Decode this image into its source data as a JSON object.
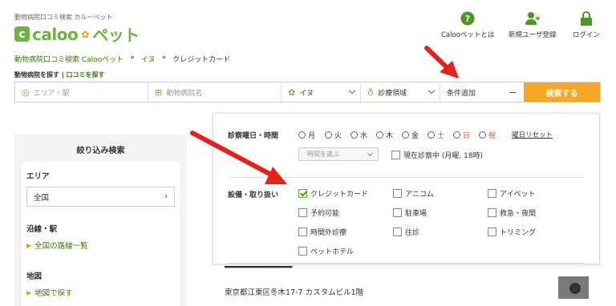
{
  "header": {
    "tagline": "動物病院口コミ検索 カルーペット",
    "logo_main": "caloo",
    "logo_sub": "ペット",
    "nav": [
      {
        "label": "Calooペットとは",
        "icon": "help-icon"
      },
      {
        "label": "新規ユーザ登録",
        "icon": "add-user-icon"
      },
      {
        "label": "ログイン",
        "icon": "lock-icon"
      }
    ]
  },
  "breadcrumb": {
    "items": [
      "動物病院口コミ検索 Calooペット",
      "イヌ",
      "クレジットカード"
    ],
    "sep": "»"
  },
  "subnav": {
    "find_hospital": "動物病院を探す",
    "sep": "|",
    "find_reviews": "口コミを探す"
  },
  "search": {
    "area_placeholder": "エリア・駅",
    "hospital_placeholder": "動物病院名",
    "animal": "イヌ",
    "field": "診療領域",
    "conditions": "条件追加",
    "submit": "検索する"
  },
  "sidebar": {
    "title": "絞り込み検索",
    "area_label": "エリア",
    "area_value": "全国",
    "line_label": "沿線・駅",
    "line_link": "全国の路線一覧",
    "map_label": "地図",
    "map_link": "地図で探す"
  },
  "panel": {
    "day_label": "診察曜日・時間",
    "days": [
      "月",
      "火",
      "水",
      "木",
      "金",
      "土",
      "日",
      "祝"
    ],
    "reset": "曜日リセット",
    "time_placeholder": "時間を選ぶ",
    "open_now": "現在診察中 (月曜, 18時)",
    "facility_label": "設備・取り扱い",
    "facilities": [
      {
        "label": "クレジットカード",
        "checked": true
      },
      {
        "label": "アニコム",
        "checked": false
      },
      {
        "label": "アイペット",
        "checked": false
      },
      {
        "label": "予約可能",
        "checked": false
      },
      {
        "label": "駐車場",
        "checked": false
      },
      {
        "label": "救急・夜間",
        "checked": false
      },
      {
        "label": "時間外診療",
        "checked": false
      },
      {
        "label": "往診",
        "checked": false
      },
      {
        "label": "トリミング",
        "checked": false
      },
      {
        "label": "ペットホテル",
        "checked": false
      }
    ]
  },
  "listing": {
    "address": "東京都江東区冬木17-7 カスタムビル1階"
  },
  "colors": {
    "brand_green": "#6db33f",
    "accent_orange": "#f5a623",
    "link_green": "#3a7d00",
    "saturday_blue": "#2a7fd4",
    "sunday_red": "#e04a1a",
    "annotation_arrow": "#e8201a"
  }
}
